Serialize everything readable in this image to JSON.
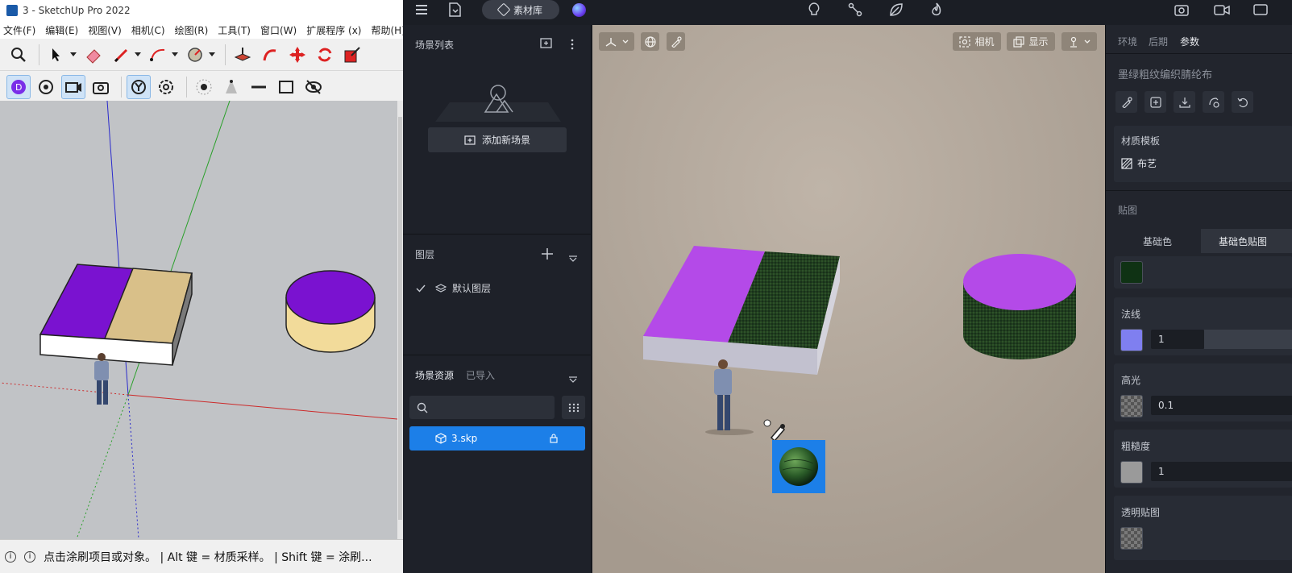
{
  "sketchup": {
    "window_title": "3 - SketchUp Pro 2022",
    "menu": [
      "文件(F)",
      "编辑(E)",
      "视图(V)",
      "相机(C)",
      "绘图(R)",
      "工具(T)",
      "窗口(W)",
      "扩展程序 (x)",
      "帮助(H)"
    ],
    "status_text": "点击涂刷项目或对象。 | Alt 键 = 材质采样。 | Shift 键 = 涂刷..."
  },
  "d5": {
    "top": {
      "material_library_label": "素材库"
    },
    "left_panel": {
      "scene_list_title": "场景列表",
      "add_scene_label": "添加新场景",
      "layers_title": "图层",
      "default_layer_label": "默认图层",
      "resources_tab": "场景资源",
      "imported_tab": "已导入",
      "search_placeholder": "",
      "file_name": "3.skp"
    },
    "viewport": {
      "camera_label": "相机",
      "display_label": "显示"
    },
    "right_panel": {
      "tabs": [
        "环境",
        "后期",
        "参数"
      ],
      "active_tab": "参数",
      "material_name": "墨绿粗纹编织腈纶布",
      "template_title": "材质模板",
      "template_value": "布艺",
      "texture_section": "贴图",
      "sub_tabs": [
        "基础色",
        "基础色贴图"
      ],
      "base_color": "#0f3214",
      "normal_label": "法线",
      "normal_value": "1",
      "normal_color": "#7f7ff0",
      "specular_label": "高光",
      "specular_value": "0.1",
      "roughness_label": "粗糙度",
      "roughness_value": "1",
      "roughness_color": "#9a9a9a",
      "opacity_label": "透明贴图"
    }
  },
  "colors": {
    "accent": "#1c7fe8",
    "purple_su": "#7a12d0",
    "tan_su": "#d9c089",
    "purple_d5": "#b44ae8",
    "fabric_green": "#223f1f"
  }
}
